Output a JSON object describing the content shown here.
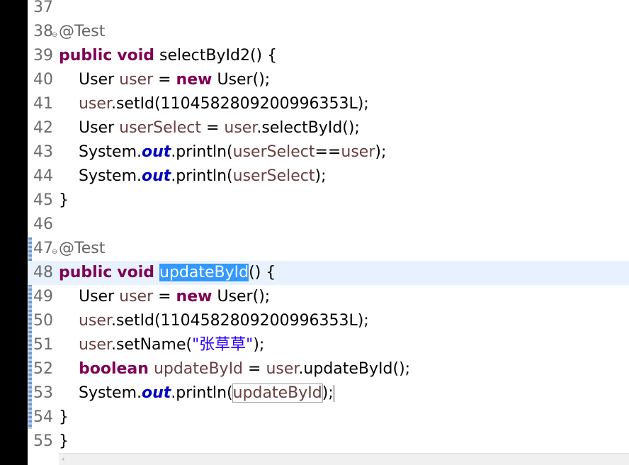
{
  "editor": {
    "lines": [
      {
        "num": "37",
        "tokens": []
      },
      {
        "num": "38",
        "fold": "⊖",
        "tokens": [
          {
            "t": "@Test",
            "c": "ann"
          }
        ]
      },
      {
        "num": "39",
        "tokens": [
          {
            "t": "public",
            "c": "kw"
          },
          {
            "t": " "
          },
          {
            "t": "void",
            "c": "kw"
          },
          {
            "t": " selectById2() {"
          }
        ]
      },
      {
        "num": "40",
        "tokens": [
          {
            "t": "    User "
          },
          {
            "t": "user",
            "c": "lv"
          },
          {
            "t": " = "
          },
          {
            "t": "new",
            "c": "kw"
          },
          {
            "t": " User();"
          }
        ]
      },
      {
        "num": "41",
        "tokens": [
          {
            "t": "    "
          },
          {
            "t": "user",
            "c": "lv"
          },
          {
            "t": ".setId(1104582809200996353L);"
          }
        ]
      },
      {
        "num": "42",
        "tokens": [
          {
            "t": "    User "
          },
          {
            "t": "userSelect",
            "c": "lv"
          },
          {
            "t": " = "
          },
          {
            "t": "user",
            "c": "lv"
          },
          {
            "t": ".selectById();"
          }
        ]
      },
      {
        "num": "43",
        "tokens": [
          {
            "t": "    System."
          },
          {
            "t": "out",
            "c": "st"
          },
          {
            "t": ".println("
          },
          {
            "t": "userSelect",
            "c": "lv"
          },
          {
            "t": "=="
          },
          {
            "t": "user",
            "c": "lv"
          },
          {
            "t": ");"
          }
        ]
      },
      {
        "num": "44",
        "tokens": [
          {
            "t": "    System."
          },
          {
            "t": "out",
            "c": "st"
          },
          {
            "t": ".println("
          },
          {
            "t": "userSelect",
            "c": "lv"
          },
          {
            "t": ");"
          }
        ]
      },
      {
        "num": "45",
        "tokens": [
          {
            "t": "}"
          }
        ]
      },
      {
        "num": "46",
        "tokens": []
      },
      {
        "num": "47",
        "fold": "⊖",
        "tokens": [
          {
            "t": "@Test",
            "c": "ann"
          }
        ]
      },
      {
        "num": "48",
        "current": true,
        "tokens": [
          {
            "t": "public",
            "c": "kw"
          },
          {
            "t": " "
          },
          {
            "t": "void",
            "c": "kw"
          },
          {
            "t": " "
          },
          {
            "t": "updateById",
            "c": "sel"
          },
          {
            "t": "() {"
          }
        ]
      },
      {
        "num": "49",
        "tokens": [
          {
            "t": "    User "
          },
          {
            "t": "user",
            "c": "lv"
          },
          {
            "t": " = "
          },
          {
            "t": "new",
            "c": "kw"
          },
          {
            "t": " User();"
          }
        ]
      },
      {
        "num": "50",
        "tokens": [
          {
            "t": "    "
          },
          {
            "t": "user",
            "c": "lv"
          },
          {
            "t": ".setId(1104582809200996353L);"
          }
        ]
      },
      {
        "num": "51",
        "tokens": [
          {
            "t": "    "
          },
          {
            "t": "user",
            "c": "lv"
          },
          {
            "t": ".setName("
          },
          {
            "t": "\"张草草\"",
            "c": "str"
          },
          {
            "t": ");"
          }
        ]
      },
      {
        "num": "52",
        "tokens": [
          {
            "t": "    "
          },
          {
            "t": "boolean",
            "c": "kw"
          },
          {
            "t": " "
          },
          {
            "t": "updateById",
            "c": "lv"
          },
          {
            "t": " = "
          },
          {
            "t": "user",
            "c": "lv"
          },
          {
            "t": ".updateById();"
          }
        ]
      },
      {
        "num": "53",
        "tokens": [
          {
            "t": "    System."
          },
          {
            "t": "out",
            "c": "st"
          },
          {
            "t": ".println("
          },
          {
            "t": "updateById",
            "c": "lv occ"
          },
          {
            "t": ");"
          },
          {
            "t": "",
            "c": "cursor"
          }
        ]
      },
      {
        "num": "54",
        "tokens": [
          {
            "t": "}"
          }
        ]
      },
      {
        "num": "55",
        "tokens": [
          {
            "t": "}"
          }
        ]
      }
    ]
  },
  "scrollbar": {
    "left_arrow": "‹"
  }
}
